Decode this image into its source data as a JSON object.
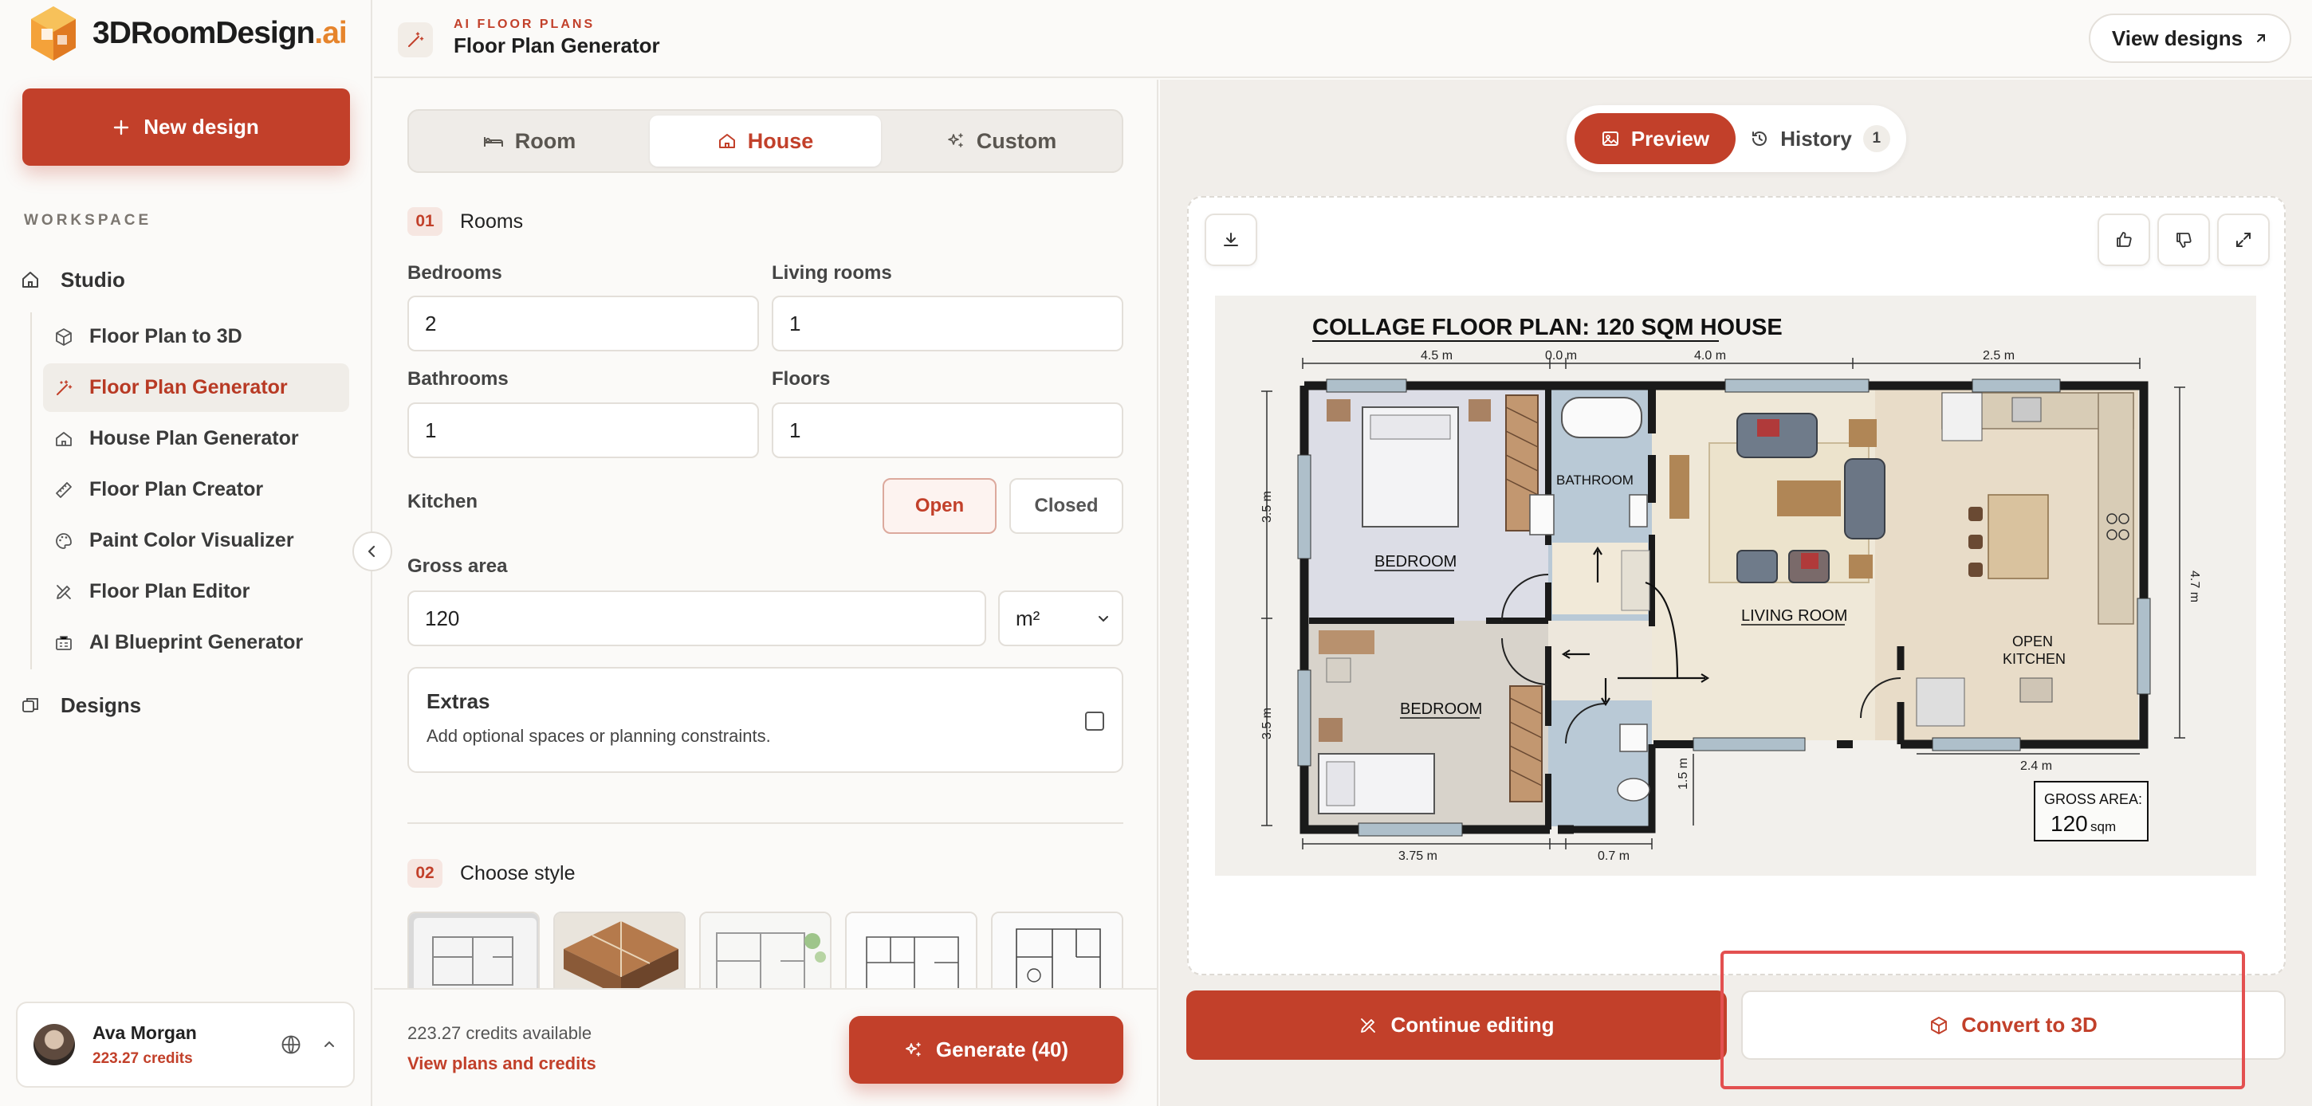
{
  "brand": {
    "name_main": "3DRoomDesign",
    "name_suffix": ".ai"
  },
  "sidebar": {
    "new_design": "New design",
    "workspace_label": "WORKSPACE",
    "studio": "Studio",
    "items": [
      {
        "label": "Floor Plan to 3D",
        "icon": "cube-icon"
      },
      {
        "label": "Floor Plan Generator",
        "icon": "magic-wand-icon",
        "active": true
      },
      {
        "label": "House Plan Generator",
        "icon": "house-icon"
      },
      {
        "label": "Floor Plan Creator",
        "icon": "ruler-icon"
      },
      {
        "label": "Paint Color Visualizer",
        "icon": "palette-icon"
      },
      {
        "label": "Floor Plan Editor",
        "icon": "edit-tools-icon"
      },
      {
        "label": "AI Blueprint Generator",
        "icon": "blueprint-icon"
      }
    ],
    "designs": "Designs",
    "user": {
      "name": "Ava Morgan",
      "credits": "223.27 credits"
    }
  },
  "header": {
    "eyebrow": "AI FLOOR PLANS",
    "title": "Floor Plan Generator",
    "view_designs": "View designs"
  },
  "form": {
    "tabs": [
      {
        "label": "Room"
      },
      {
        "label": "House",
        "active": true
      },
      {
        "label": "Custom"
      }
    ],
    "section1": {
      "num": "01",
      "title": "Rooms"
    },
    "bedrooms": {
      "label": "Bedrooms",
      "value": "2"
    },
    "living_rooms": {
      "label": "Living rooms",
      "value": "1"
    },
    "bathrooms": {
      "label": "Bathrooms",
      "value": "1"
    },
    "floors": {
      "label": "Floors",
      "value": "1"
    },
    "kitchen": {
      "label": "Kitchen",
      "open": "Open",
      "closed": "Closed",
      "selected": "Open"
    },
    "gross_area": {
      "label": "Gross area",
      "value": "120",
      "unit": "m²"
    },
    "extras": {
      "title": "Extras",
      "desc": "Add optional spaces or planning constraints.",
      "checked": false
    },
    "section2": {
      "num": "02",
      "title": "Choose style"
    },
    "footer": {
      "credits": "223.27 credits available",
      "plans_link": "View plans and credits",
      "generate": "Generate (40)"
    }
  },
  "preview": {
    "tab_preview": "Preview",
    "tab_history": "History",
    "history_count": "1",
    "plan": {
      "title": "COLLAGE FLOOR PLAN: 120 SQM HOUSE",
      "dim_top": [
        "4.5 m",
        "0.0 m",
        "4.0 m",
        "2.5 m"
      ],
      "dim_bottom": [
        "3.75 m",
        "0.7 m"
      ],
      "dim_left": [
        "3.5 m",
        "3.5 m"
      ],
      "dim_right": "4.7 m",
      "dim_mid": "1.5 m",
      "dim_kitchen": "2.4 m",
      "rooms": {
        "bedroom1": "BEDROOM",
        "bedroom2": "BEDROOM",
        "bathroom": "BATHROOM",
        "living": "LIVING ROOM",
        "kitchen_l1": "OPEN",
        "kitchen_l2": "KITCHEN"
      },
      "gross_label": "GROSS AREA:",
      "gross_value": "120",
      "gross_unit": "sqm"
    },
    "continue_editing": "Continue editing",
    "convert_3d": "Convert to 3D"
  }
}
